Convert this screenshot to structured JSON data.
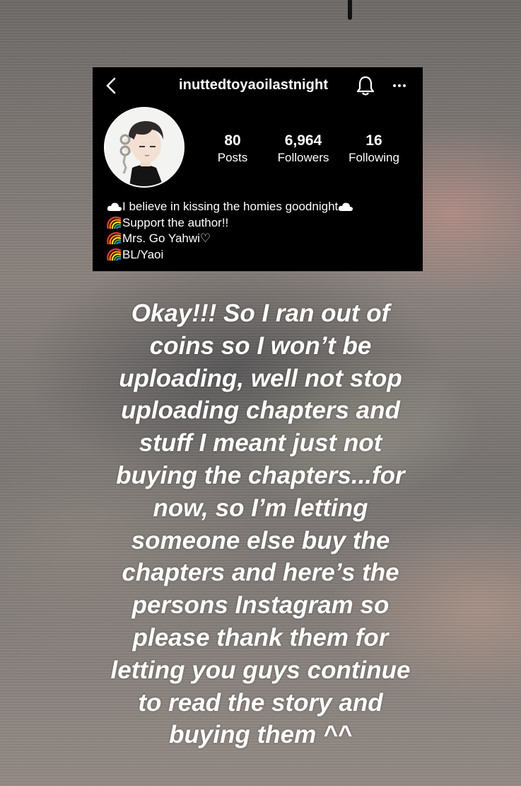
{
  "profile": {
    "username": "inuttedtoyaoilastnight",
    "stats": [
      {
        "value": "80",
        "label": "Posts"
      },
      {
        "value": "6,964",
        "label": "Followers"
      },
      {
        "value": "16",
        "label": "Following"
      }
    ],
    "bio": [
      {
        "icon": "cloud-icon",
        "text": "I believe in kissing the homies goodnight",
        "trailing_icon": "cloud-icon"
      },
      {
        "icon": "rainbow-icon",
        "text": "Support the author!!"
      },
      {
        "icon": "rainbow-icon",
        "text": "Mrs. Go Yahwi♡"
      },
      {
        "icon": "rainbow-icon",
        "text": "BL/Yaoi"
      }
    ]
  },
  "story": {
    "lines": [
      "Okay!!! So I ran out of",
      "coins so I won’t be",
      "uploading, well not stop",
      "uploading chapters and",
      "stuff I meant just not",
      "buying the chapters...for",
      "now, so I’m letting",
      "someone else buy the",
      "chapters and here’s the",
      "persons Instagram so",
      "please thank them for",
      "letting you guys continue",
      "to read the story and",
      "buying them ^^"
    ]
  },
  "colors": {
    "card_bg": "#000000",
    "text": "#ffffff"
  }
}
